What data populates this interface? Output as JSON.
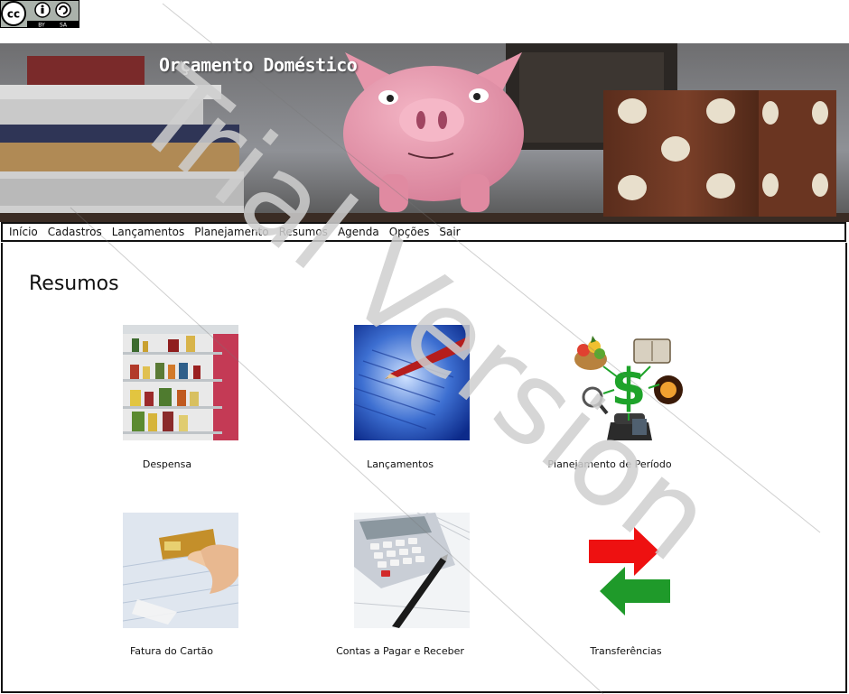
{
  "license_badge": {
    "icon": "creative-commons-by-sa-icon",
    "by": "BY",
    "sa": "SA",
    "cc": "cc"
  },
  "banner": {
    "title": "Orçamento Doméstico"
  },
  "nav": {
    "items": [
      "Início",
      "Cadastros",
      "Lançamentos",
      "Planejamento",
      "Resumos",
      "Agenda",
      "Opções",
      "Sair"
    ]
  },
  "page": {
    "title": "Resumos"
  },
  "tiles": [
    {
      "label": "Despensa",
      "icon": "pantry-shelves-icon"
    },
    {
      "label": "Lançamentos",
      "icon": "ledger-pencil-icon"
    },
    {
      "label": "Planejamento de Período",
      "icon": "dollar-planning-icon"
    },
    {
      "label": "Fatura do Cartão",
      "icon": "credit-card-icon"
    },
    {
      "label": "Contas a Pagar e Receber",
      "icon": "calculator-icon"
    },
    {
      "label": "Transferências",
      "icon": "transfer-arrows-icon"
    }
  ],
  "watermark": {
    "text": "Trial Version"
  }
}
